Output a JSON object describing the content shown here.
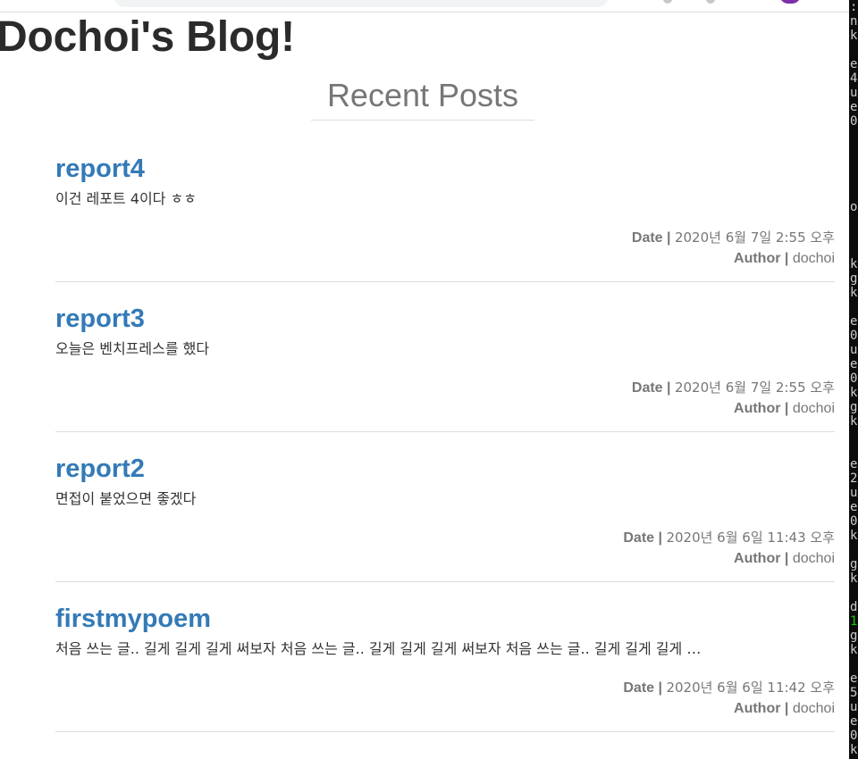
{
  "site": {
    "title": "Dochoi's Blog!"
  },
  "section": {
    "title": "Recent Posts"
  },
  "meta_labels": {
    "date": "Date",
    "author": "Author",
    "separator": "|"
  },
  "posts": [
    {
      "title": "report4",
      "excerpt": "이건 레포트 4이다 ㅎㅎ",
      "date": "2020년 6월 7일 2:55 오후",
      "author": "dochoi"
    },
    {
      "title": "report3",
      "excerpt": "오늘은 벤치프레스를 했다",
      "date": "2020년 6월 7일 2:55 오후",
      "author": "dochoi"
    },
    {
      "title": "report2",
      "excerpt": "면접이 붙었으면 좋겠다",
      "date": "2020년 6월 6일 11:43 오후",
      "author": "dochoi"
    },
    {
      "title": "firstmypoem",
      "excerpt": "처음 쓰는 글.. 길게 길게 길게 써보자 처음 쓰는 글.. 길게 길게 길게 써보자 처음 쓰는 글.. 길게 길게 길게 …",
      "date": "2020년 6월 6일 11:42 오후",
      "author": "dochoi"
    }
  ],
  "colors": {
    "link": "#337ab7",
    "title": "#2b2b2b",
    "muted": "#777777",
    "divider": "#dddddd"
  }
}
